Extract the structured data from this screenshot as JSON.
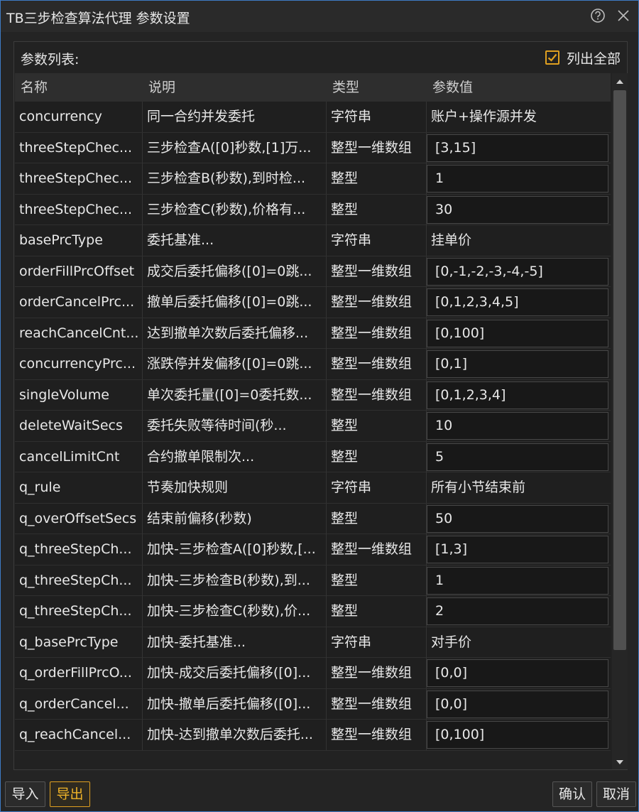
{
  "window": {
    "title": "TB三步检查算法代理 参数设置",
    "help_icon": "help-circle-icon",
    "close_icon": "close-icon"
  },
  "panel": {
    "label": "参数列表:",
    "list_all_label": "列出全部",
    "list_all_checked": true
  },
  "table": {
    "headers": [
      "名称",
      "说明",
      "类型",
      "参数值"
    ],
    "rows": [
      {
        "name": "concurrency",
        "desc": "同一合约并发委托",
        "type": "字符串",
        "value": "账户+操作源并发",
        "editable": false
      },
      {
        "name": "threeStepChec...",
        "desc": "三步检查A([0]秒数,[1]万...",
        "type": "整型一维数组",
        "value": "[3,15]",
        "editable": true
      },
      {
        "name": "threeStepChec...",
        "desc": "三步检查B(秒数),到时检...",
        "type": "整型",
        "value": "1",
        "editable": true
      },
      {
        "name": "threeStepChec...",
        "desc": "三步检查C(秒数),价格有...",
        "type": "整型",
        "value": "30",
        "editable": true
      },
      {
        "name": "basePrcType",
        "desc": "委托基准...",
        "type": "字符串",
        "value": "挂单价",
        "editable": false
      },
      {
        "name": "orderFillPrcOffset",
        "desc": "成交后委托偏移([0]=0跳...",
        "type": "整型一维数组",
        "value": "[0,-1,-2,-3,-4,-5]",
        "editable": true
      },
      {
        "name": "orderCancelPrc...",
        "desc": "撤单后委托偏移([0]=0跳...",
        "type": "整型一维数组",
        "value": "[0,1,2,3,4,5]",
        "editable": true
      },
      {
        "name": "reachCancelCnt...",
        "desc": "达到撤单次数后委托偏移...",
        "type": "整型一维数组",
        "value": "[0,100]",
        "editable": true
      },
      {
        "name": "concurrencyPrc...",
        "desc": "涨跌停并发偏移([0]=0跳...",
        "type": "整型一维数组",
        "value": "[0,1]",
        "editable": true
      },
      {
        "name": "singleVolume",
        "desc": "单次委托量([0]=0委托数...",
        "type": "整型一维数组",
        "value": "[0,1,2,3,4]",
        "editable": true
      },
      {
        "name": "deleteWaitSecs",
        "desc": "委托失败等待时间(秒...",
        "type": "整型",
        "value": "10",
        "editable": true
      },
      {
        "name": "cancelLimitCnt",
        "desc": "合约撤单限制次...",
        "type": "整型",
        "value": "5",
        "editable": true
      },
      {
        "name": "q_rule",
        "desc": "节奏加快规则",
        "type": "字符串",
        "value": "所有小节结束前",
        "editable": false
      },
      {
        "name": "q_overOffsetSecs",
        "desc": "结束前偏移(秒数)",
        "type": "整型",
        "value": "50",
        "editable": true
      },
      {
        "name": "q_threeStepCh...",
        "desc": "加快-三步检查A([0]秒数,[...",
        "type": "整型一维数组",
        "value": "[1,3]",
        "editable": true
      },
      {
        "name": "q_threeStepCh...",
        "desc": "加快-三步检查B(秒数),到...",
        "type": "整型",
        "value": "1",
        "editable": true
      },
      {
        "name": "q_threeStepCh...",
        "desc": "加快-三步检查C(秒数),价...",
        "type": "整型",
        "value": "2",
        "editable": true
      },
      {
        "name": "q_basePrcType",
        "desc": "加快-委托基准...",
        "type": "字符串",
        "value": "对手价",
        "editable": false
      },
      {
        "name": "q_orderFillPrcO...",
        "desc": "加快-成交后委托偏移([0]...",
        "type": "整型一维数组",
        "value": "[0,0]",
        "editable": true
      },
      {
        "name": "q_orderCancel...",
        "desc": "加快-撤单后委托偏移([0]...",
        "type": "整型一维数组",
        "value": "[0,0]",
        "editable": true
      },
      {
        "name": "q_reachCancel...",
        "desc": "加快-达到撤单次数后委托...",
        "type": "整型一维数组",
        "value": "[0,100]",
        "editable": true
      }
    ]
  },
  "footer": {
    "import_label": "导入",
    "export_label": "导出",
    "ok_label": "确认",
    "cancel_label": "取消"
  },
  "colors": {
    "accent": "#e0a020",
    "window_border": "#3e7bc4",
    "background": "#242424"
  }
}
